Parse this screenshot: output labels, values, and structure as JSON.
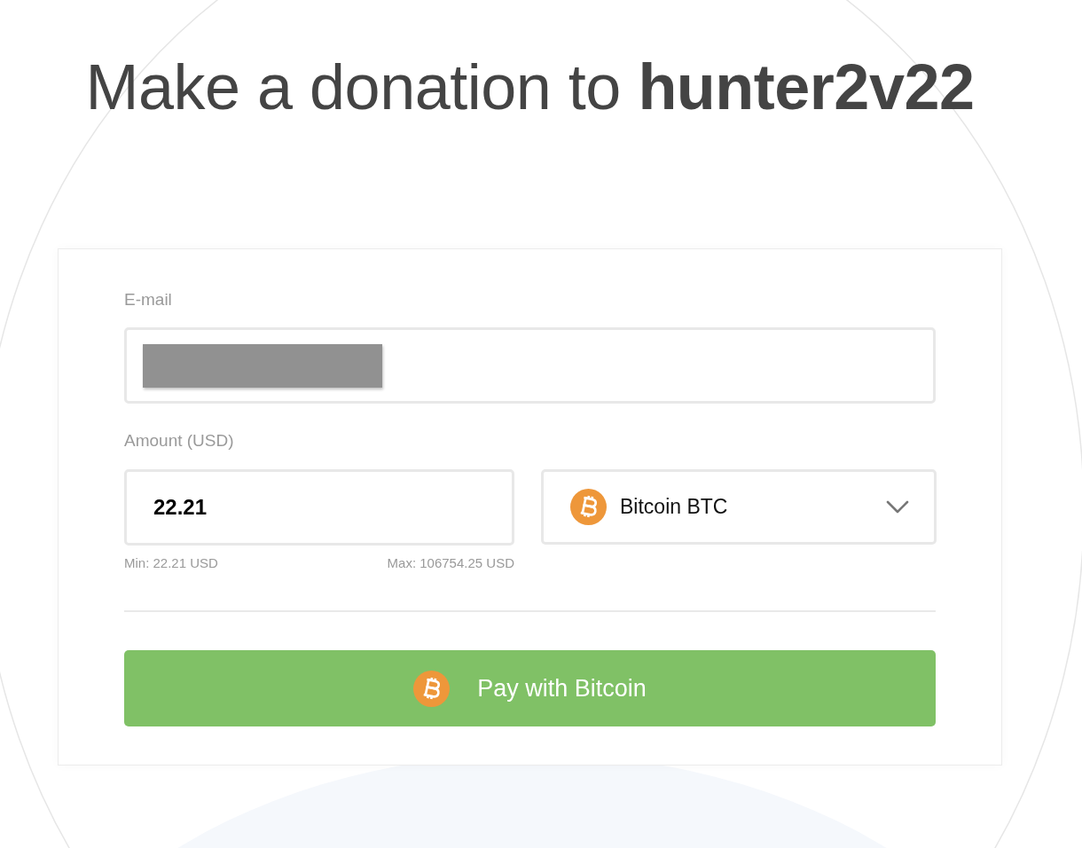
{
  "title": {
    "text": "Make a donation to **hunter2v22**"
  },
  "form": {
    "email": {
      "label": "E-mail",
      "redacted": true
    },
    "amount": {
      "label": "Amount (USD)",
      "value": "22.21",
      "min": "Min: 22.21 USD",
      "max": "Max: 106754.25 USD"
    },
    "currency": {
      "label": "Bitcoin BTC",
      "expanded": false
    },
    "pay_button": {
      "label": "Pay with Bitcoin"
    }
  }
}
